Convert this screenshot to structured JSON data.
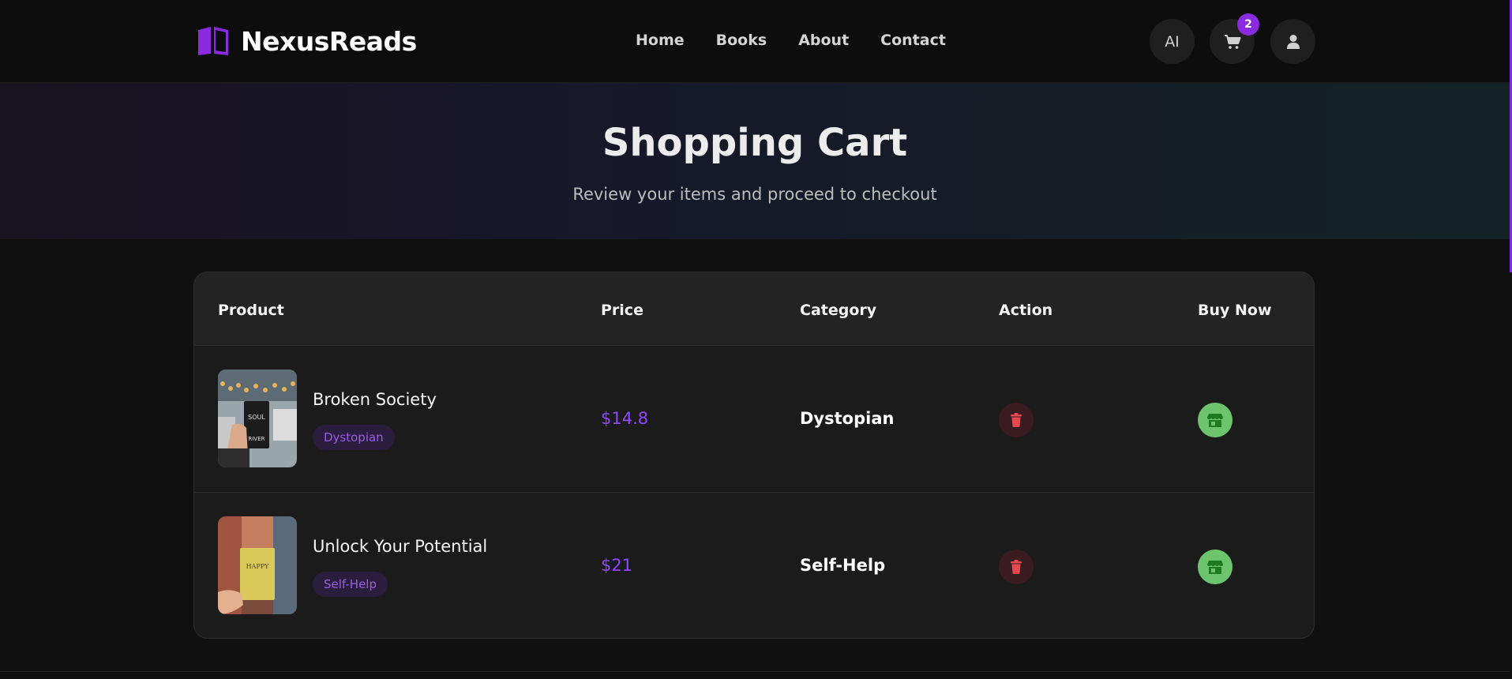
{
  "brand": {
    "name": "NexusReads"
  },
  "nav": {
    "links": [
      "Home",
      "Books",
      "About",
      "Contact"
    ]
  },
  "actions": {
    "ai_label": "AI",
    "cart_count": "2"
  },
  "hero": {
    "title": "Shopping Cart",
    "subtitle": "Review your items and proceed to checkout"
  },
  "table": {
    "headers": [
      "Product",
      "Price",
      "Category",
      "Action",
      "Buy Now"
    ],
    "rows": [
      {
        "name": "Broken Society",
        "tag": "Dystopian",
        "price": "$14.8",
        "category": "Dystopian",
        "cover_text": [
          "SOUL",
          "RIVER"
        ]
      },
      {
        "name": "Unlock Your Potential",
        "tag": "Self-Help",
        "price": "$21",
        "category": "Self-Help",
        "cover_text": [
          "HAPPY"
        ]
      }
    ]
  },
  "colors": {
    "accent": "#8a2be2",
    "price": "#9147ff",
    "delete_bg": "#3a1c20",
    "delete_icon": "#e5484d",
    "buy_bg": "#6cc46c",
    "buy_icon": "#1e7a1e"
  },
  "icons": {
    "logo": "book-icon",
    "cart": "cart-icon",
    "user": "user-icon",
    "delete": "trash-icon",
    "buy": "store-icon"
  }
}
